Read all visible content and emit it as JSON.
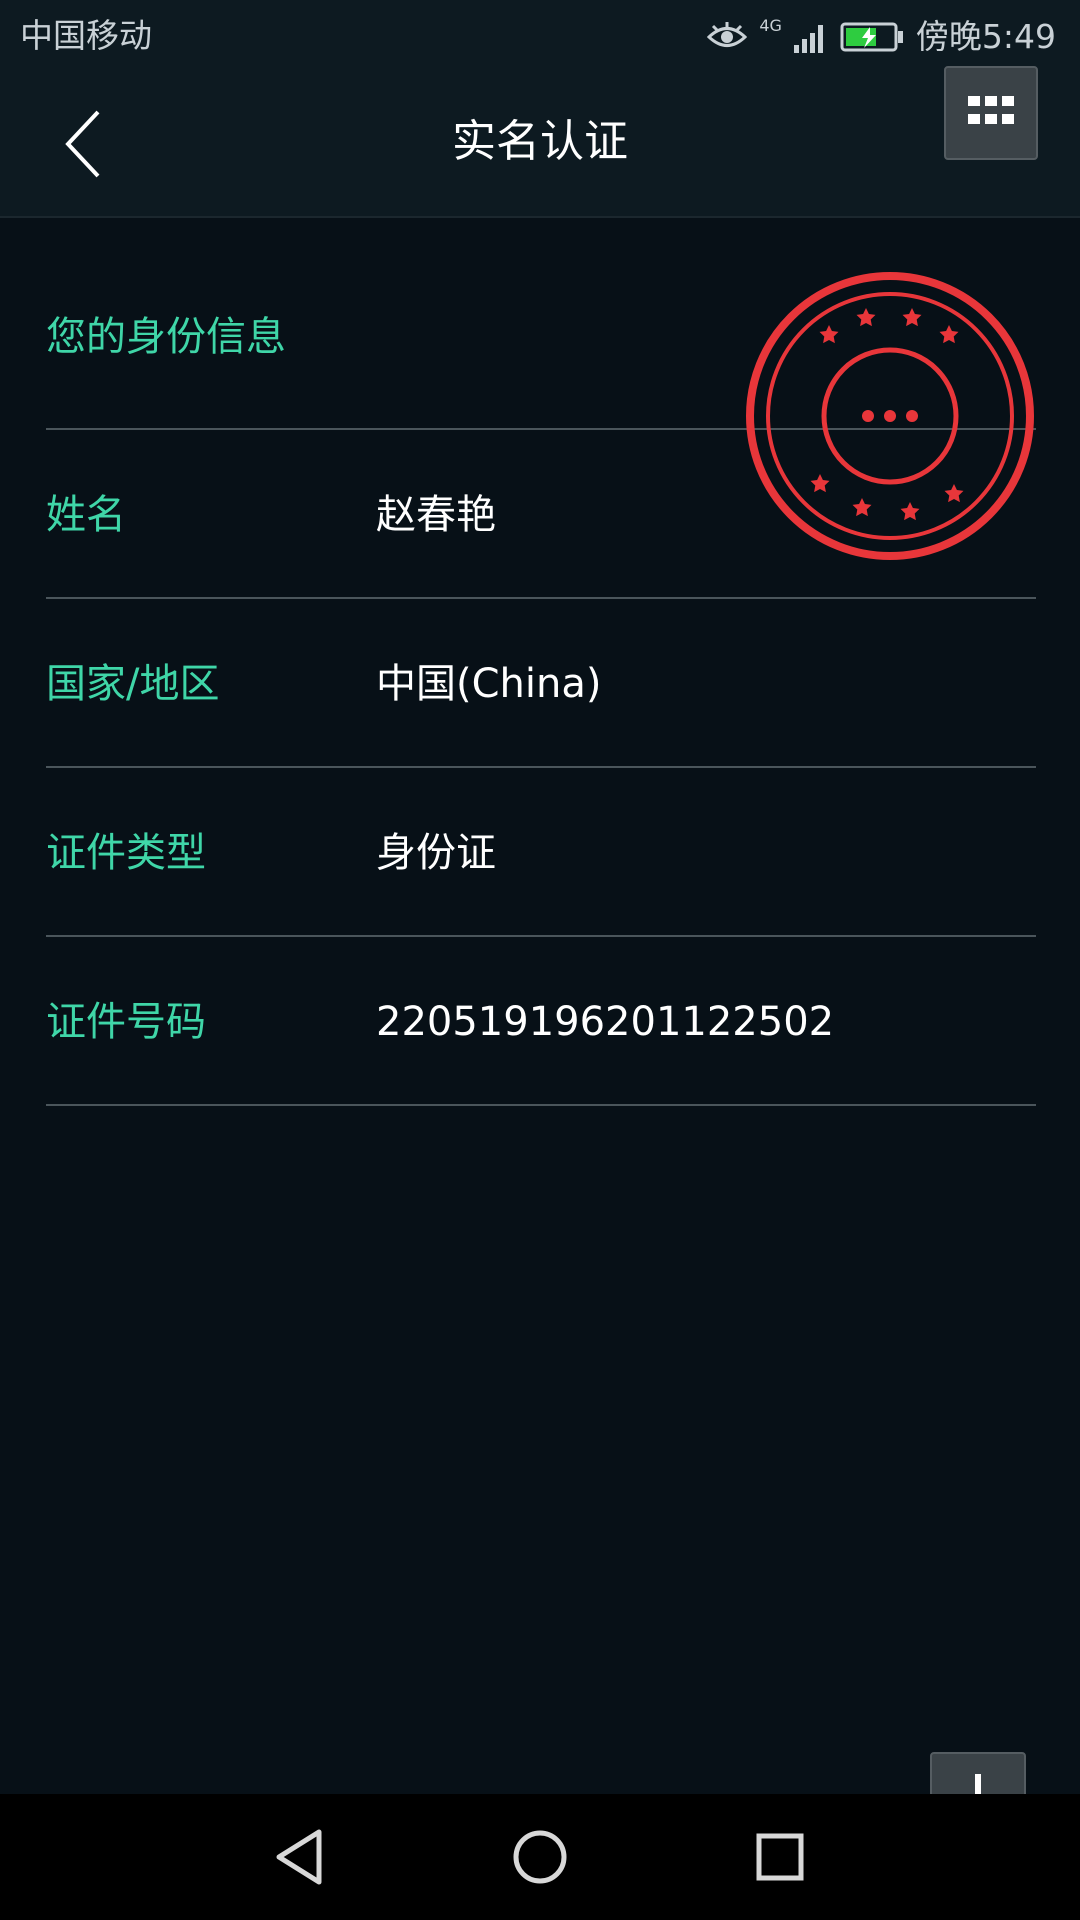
{
  "status_bar": {
    "carrier": "中国移动",
    "network": "4G",
    "time": "傍晚5:49",
    "battery_color": "#2ecc40"
  },
  "app_bar": {
    "title": "实名认证",
    "back_icon": "chevron-left-icon",
    "menu_icon": "grid-icon"
  },
  "identity": {
    "section_title": "您的身份信息",
    "rows": [
      {
        "label": "姓名",
        "value": "赵春艳"
      },
      {
        "label": "国家/地区",
        "value": "中国(China)"
      },
      {
        "label": "证件类型",
        "value": "身份证"
      },
      {
        "label": "证件号码",
        "value": "220519196201122502"
      }
    ]
  },
  "stamp": {
    "color": "#e8363a",
    "icon": "seal-stamp-icon"
  },
  "colors": {
    "background": "#071017",
    "label_accent": "#3fd6a8",
    "divider": "#4a555b"
  },
  "nav": {
    "back_icon": "triangle-back-icon",
    "home_icon": "circle-home-icon",
    "recents_icon": "square-recents-icon",
    "download_icon": "download-icon"
  }
}
